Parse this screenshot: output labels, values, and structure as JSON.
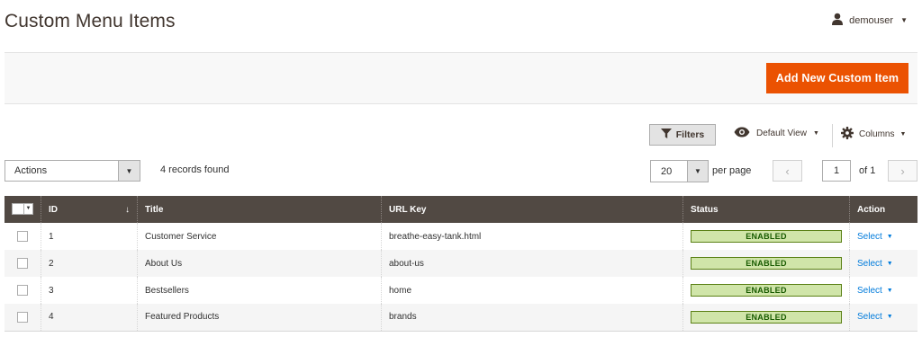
{
  "page": {
    "title": "Custom Menu Items"
  },
  "user": {
    "name": "demouser"
  },
  "toolbar": {
    "add_button": "Add New Custom Item",
    "filters": "Filters",
    "view": "Default View",
    "columns": "Columns"
  },
  "grid_controls": {
    "actions_label": "Actions",
    "records_found": "4 records found",
    "per_page_value": "20",
    "per_page_label": "per page",
    "page_current": "1",
    "page_total": "of 1"
  },
  "table": {
    "headers": {
      "id": "ID",
      "title": "Title",
      "url_key": "URL Key",
      "status": "Status",
      "action": "Action"
    },
    "sort_indicator": "↓",
    "rows": [
      {
        "id": "1",
        "title": "Customer Service",
        "url_key": "breathe-easy-tank.html",
        "status": "ENABLED",
        "action": "Select"
      },
      {
        "id": "2",
        "title": "About Us",
        "url_key": "about-us",
        "status": "ENABLED",
        "action": "Select"
      },
      {
        "id": "3",
        "title": "Bestsellers",
        "url_key": "home",
        "status": "ENABLED",
        "action": "Select"
      },
      {
        "id": "4",
        "title": "Featured Products",
        "url_key": "brands",
        "status": "ENABLED",
        "action": "Select"
      }
    ]
  },
  "colors": {
    "primary_button": "#eb5202",
    "table_header": "#514943",
    "status_bg": "#d0e5a9",
    "status_border": "#5b8116",
    "status_text": "#185b00",
    "link": "#007bdb"
  },
  "icons": {
    "user": "user-icon",
    "filter": "funnel-icon",
    "view": "eye-icon",
    "columns": "gear-icon",
    "prev": "chevron-left-icon",
    "next": "chevron-right-icon"
  }
}
